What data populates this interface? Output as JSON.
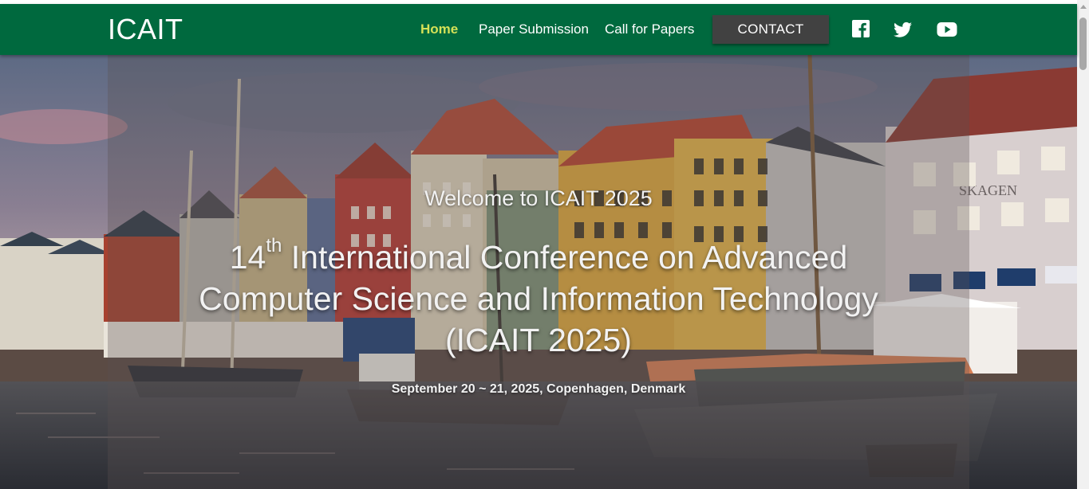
{
  "navbar": {
    "brand": "ICAIT",
    "links": [
      {
        "label": "Home",
        "active": true
      },
      {
        "label": "Paper Submission",
        "active": false
      },
      {
        "label": "Call for Papers",
        "active": false
      }
    ],
    "contact_label": "CONTACT",
    "social_icons": [
      "facebook-icon",
      "twitter-icon",
      "youtube-icon"
    ],
    "bg_color": "#00693e",
    "active_color": "#d4e157"
  },
  "hero": {
    "welcome": "Welcome to ICAIT 2025",
    "title_number": "14",
    "title_suffix": "th",
    "title_line1_rest": " International Conference on Advanced",
    "title_line2": "Computer Science and Information Technology",
    "title_line3": "(ICAIT 2025)",
    "date_location": "September 20 ~ 21, 2025, Copenhagen, Denmark",
    "sign_text": "SKAGEN"
  }
}
